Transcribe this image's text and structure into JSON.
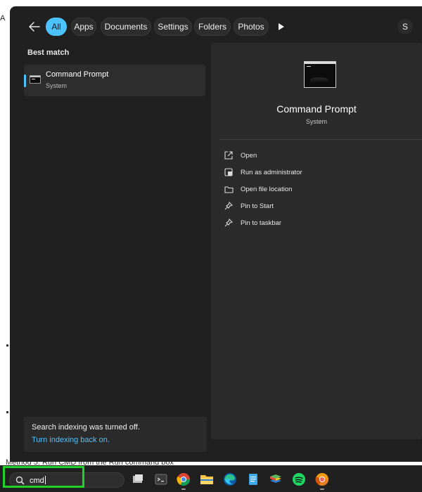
{
  "filters": {
    "tabs": [
      {
        "label": "All",
        "active": true
      },
      {
        "label": "Apps",
        "active": false
      },
      {
        "label": "Documents",
        "active": false
      },
      {
        "label": "Settings",
        "active": false
      },
      {
        "label": "Folders",
        "active": false
      },
      {
        "label": "Photos",
        "active": false
      }
    ],
    "user_initial": "S"
  },
  "best_match": {
    "heading": "Best match",
    "title": "Command Prompt",
    "subtitle": "System"
  },
  "detail": {
    "app_name": "Command Prompt",
    "app_type": "System",
    "actions": [
      {
        "label": "Open",
        "icon": "open-icon"
      },
      {
        "label": "Run as administrator",
        "icon": "shield-icon"
      },
      {
        "label": "Open file location",
        "icon": "folder-icon"
      },
      {
        "label": "Pin to Start",
        "icon": "pin-icon"
      },
      {
        "label": "Pin to taskbar",
        "icon": "pin-icon"
      }
    ]
  },
  "notice": {
    "message": "Search indexing was turned off.",
    "link": "Turn indexing back on."
  },
  "taskbar": {
    "search_value": "cmd",
    "apps": [
      "task-view-icon",
      "terminal-icon",
      "chrome-icon",
      "file-explorer-icon",
      "edge-icon",
      "notepad-icon",
      "bluestacks-icon",
      "spotify-icon",
      "chrome-canary-icon"
    ]
  },
  "background": {
    "left_fragment": "A",
    "bottom_text": "Method 5: Run CMD from the Run command box"
  },
  "colors": {
    "accent": "#4cc2ff",
    "highlight": "#22d02a",
    "panel": "#202020"
  }
}
